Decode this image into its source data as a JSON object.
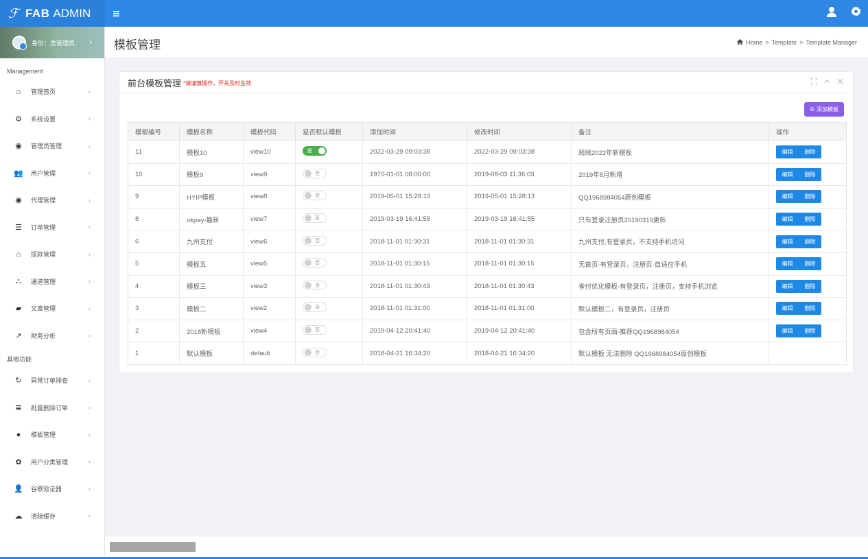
{
  "brand": {
    "logo": "ℱ",
    "name_bold": "FAB",
    "name_light": "ADMIN"
  },
  "topbar": {
    "menu_icon": "hamburger-icon",
    "icons": [
      "user-icon",
      "gear-icon"
    ]
  },
  "profile": {
    "role_label": "身份：总管理员",
    "arrow": "›"
  },
  "sidebar": {
    "section1": "Management",
    "items1": [
      {
        "label": "管理首页",
        "icon": "home-icon",
        "glyph": "⌂"
      },
      {
        "label": "系统设置",
        "icon": "cogs-icon",
        "glyph": "⚙"
      },
      {
        "label": "管理员管理",
        "icon": "user-circle-icon",
        "glyph": "◉"
      },
      {
        "label": "用户管理",
        "icon": "users-icon",
        "glyph": "👥"
      },
      {
        "label": "代理管理",
        "icon": "user-circle-icon",
        "glyph": "◉"
      },
      {
        "label": "订单管理",
        "icon": "list-icon",
        "glyph": "☰"
      },
      {
        "label": "提款管理",
        "icon": "bag-icon",
        "glyph": "⌂"
      },
      {
        "label": "通道管理",
        "icon": "bank-icon",
        "glyph": "⛬"
      },
      {
        "label": "文章管理",
        "icon": "book-icon",
        "glyph": "▰"
      },
      {
        "label": "财务分析",
        "icon": "chart-line-icon",
        "glyph": "↗"
      }
    ],
    "section2": "其他功能",
    "items2": [
      {
        "label": "异常订单排查",
        "icon": "refresh-icon",
        "glyph": "↻"
      },
      {
        "label": "批量删除订单",
        "icon": "bars-icon",
        "glyph": "≣"
      },
      {
        "label": "模板管理",
        "icon": "apple-icon",
        "glyph": "●"
      },
      {
        "label": "用户分类管理",
        "icon": "wechat-icon",
        "glyph": "✿"
      },
      {
        "label": "谷歌验证器",
        "icon": "user-icon",
        "glyph": "👤"
      },
      {
        "label": "清除缓存",
        "icon": "cloud-icon",
        "glyph": "☁"
      }
    ],
    "chevron": "›"
  },
  "header": {
    "title": "模板管理",
    "breadcrumb": {
      "home": "Home",
      "sep": ">",
      "level1": "Template",
      "level2": "Template Manager"
    }
  },
  "panel": {
    "title": "前台模板管理",
    "note": "*请谨慎操作，开关及时生效",
    "tools": [
      "expand-icon",
      "collapse-icon",
      "close-icon"
    ],
    "add_button": "⊕ 添加模板"
  },
  "table": {
    "columns": [
      "模板编号",
      "模板名称",
      "模板代码",
      "是否默认模板",
      "添加时间",
      "修改时间",
      "备注",
      "操作"
    ],
    "edit_label": "编辑",
    "delete_label": "删除",
    "rows": [
      {
        "id": "11",
        "name": "模板10",
        "code": "view10",
        "default": true,
        "toggle": "是",
        "added": "2022-03-29 09:03:38",
        "modified": "2022-03-29 09:03:38",
        "note": "贱贱2022年新模板",
        "ops": true
      },
      {
        "id": "10",
        "name": "模板9",
        "code": "view9",
        "default": false,
        "toggle": "否",
        "added": "1970-01-01 08:00:00",
        "modified": "2019-08-03 11:36:03",
        "note": "2019年8月新增",
        "ops": true
      },
      {
        "id": "9",
        "name": "HYIP模板",
        "code": "view8",
        "default": false,
        "toggle": "否",
        "added": "2019-05-01 15:28:13",
        "modified": "2019-05-01 15:28:13",
        "note": "QQ1968984054原创模板",
        "ops": true
      },
      {
        "id": "8",
        "name": "okpay-最新",
        "code": "view7",
        "default": false,
        "toggle": "否",
        "added": "2019-03-19 16:41:55",
        "modified": "2019-03-19 16:41:55",
        "note": "只有登录注册页20190319更新",
        "ops": true
      },
      {
        "id": "6",
        "name": "九州支付",
        "code": "view6",
        "default": false,
        "toggle": "否",
        "added": "2018-11-01 01:30:31",
        "modified": "2018-11-01 01:30:31",
        "note": "九州支付,有登录页，不支持手机访问",
        "ops": true
      },
      {
        "id": "5",
        "name": "模板五",
        "code": "view5",
        "default": false,
        "toggle": "否",
        "added": "2018-11-01 01:30:15",
        "modified": "2018-11-01 01:30:15",
        "note": "无首页-有登录页，注册页-自适应手机",
        "ops": true
      },
      {
        "id": "4",
        "name": "模板三",
        "code": "view3",
        "default": false,
        "toggle": "否",
        "added": "2018-11-01 01:30:43",
        "modified": "2018-11-01 01:30:43",
        "note": "雀付优化模板-有登录页，注册页，支持手机浏览",
        "ops": true
      },
      {
        "id": "3",
        "name": "模板二",
        "code": "view2",
        "default": false,
        "toggle": "否",
        "added": "2018-11-01 01:31:00",
        "modified": "2018-11-01 01:31:00",
        "note": "默认模板二，有登录页，注册页",
        "ops": true
      },
      {
        "id": "2",
        "name": "2018新模板",
        "code": "view4",
        "default": false,
        "toggle": "否",
        "added": "2019-04-12 20:41:40",
        "modified": "2019-04-12 20:41:40",
        "note": "包含所有页面-推荐QQ1968984054",
        "ops": true
      },
      {
        "id": "1",
        "name": "默认模板",
        "code": "default",
        "default": false,
        "toggle": "否",
        "added": "2018-04-21 16:34:20",
        "modified": "2018-04-21 16:34:20",
        "note": "默认模板 无法删除 QQ1968984054原创模板",
        "ops": false
      }
    ]
  },
  "colors": {
    "primary": "#2e88e3",
    "accent_purple": "#8a5ee8",
    "toggle_on": "#4cae4c",
    "note_red": "#e02020"
  }
}
